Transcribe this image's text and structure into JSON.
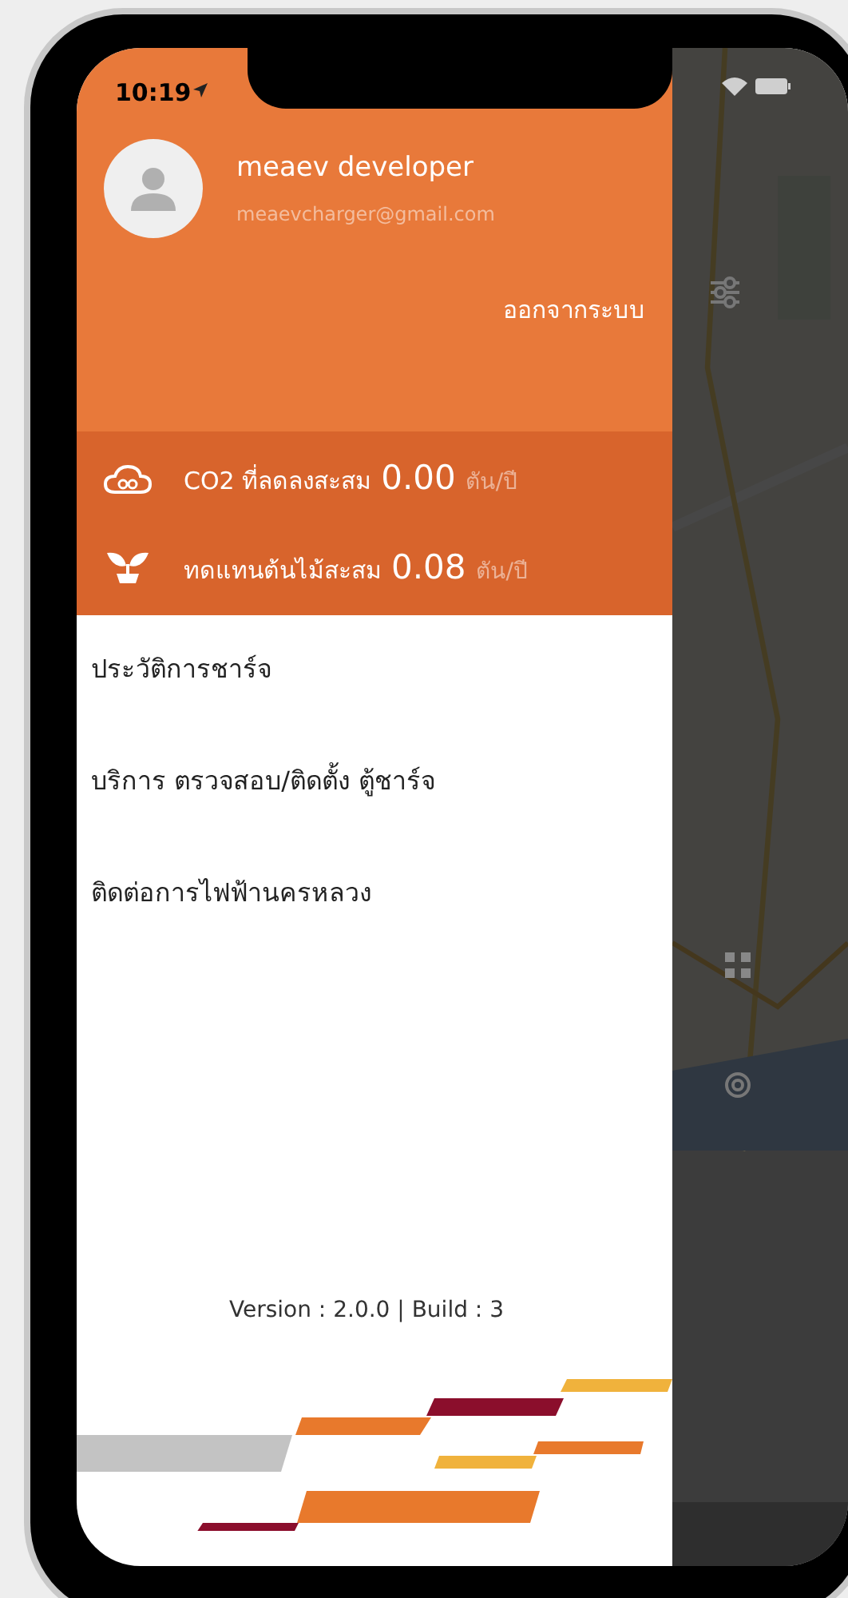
{
  "status_bar": {
    "time": "10:19"
  },
  "profile": {
    "name": "meaev developer",
    "email": "meaevcharger@gmail.com"
  },
  "logout": "ออกจากระบบ",
  "stats": [
    {
      "kind": "co2",
      "label": "CO2 ที่ลดลงสะสม",
      "value": "0.00",
      "unit": "ตัน/ปี"
    },
    {
      "kind": "tree",
      "label": "ทดแทนต้นไม้สะสม",
      "value": "0.08",
      "unit": "ตัน/ปี"
    }
  ],
  "menu": [
    {
      "label": "ประวัติการชาร์จ"
    },
    {
      "label": "บริการ ตรวจสอบ/ติดตั้ง ตู้ชาร์จ"
    },
    {
      "label": "ติดต่อการไฟฟ้านครหลวง"
    }
  ],
  "version": "Version : 2.0.0 | Build : 3"
}
